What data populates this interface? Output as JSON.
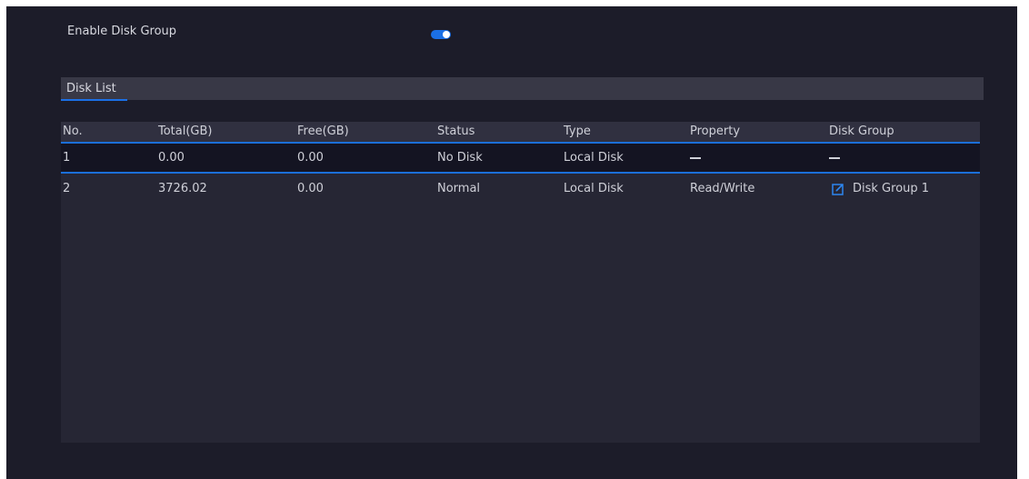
{
  "settings": {
    "enable_disk_group_label": "Enable Disk Group",
    "enable_disk_group_on": true
  },
  "section": {
    "title": "Disk List"
  },
  "table": {
    "headers": [
      "No.",
      "Total(GB)",
      "Free(GB)",
      "Status",
      "Type",
      "Property",
      "Disk Group"
    ],
    "rows": [
      {
        "no": "1",
        "total": "0.00",
        "free": "0.00",
        "status": "No Disk",
        "type": "Local Disk",
        "property": "—",
        "disk_group": "—"
      },
      {
        "no": "2",
        "total": "3726.02",
        "free": "0.00",
        "status": "Normal",
        "type": "Local Disk",
        "property": "Read/Write",
        "disk_group": "Disk Group 1",
        "disk_group_icon": "edit-icon"
      }
    ]
  },
  "colors": {
    "accent": "#1b70e6",
    "background": "#1c1c29",
    "panel": "#262634",
    "header": "#303040",
    "selected_row": "#141422"
  }
}
